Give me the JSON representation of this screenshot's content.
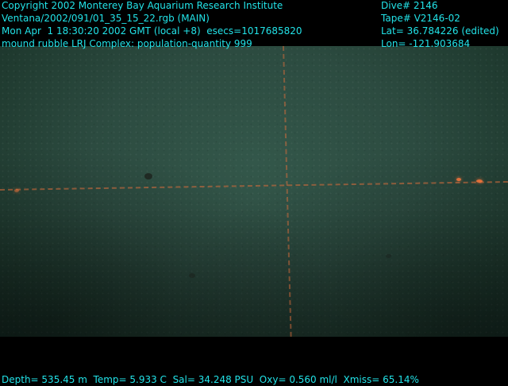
{
  "overlay": {
    "copyright": "Copyright 2002 Monterey Bay Aquarium Research Institute",
    "file": "Ventana/2002/091/01_35_15_22.rgb (MAIN)",
    "datetime": "Mon Apr  1 18:30:20 2002 GMT (local +8)  esecs=1017685820",
    "annotation": "mound rubble LRJ Complex: population-quantity 999",
    "dive": "Dive# 2146",
    "tape": "Tape# V2146-02",
    "lat": "Lat= 36.784226 (edited)",
    "lon": "Lon= -121.903684",
    "sensors": "Depth= 535.45 m  Temp= 5.933 C  Sal= 34.248 PSU  Oxy= 0.560 ml/l  Xmiss= 65.14%"
  },
  "colors": {
    "overlay_text": "#22e3e8",
    "water": "#2c4b40",
    "laser": "#dc6e3c"
  }
}
